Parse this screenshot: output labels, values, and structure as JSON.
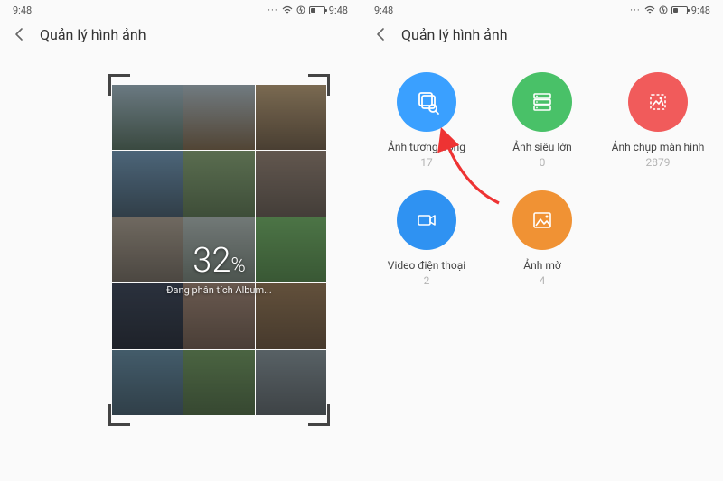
{
  "statusbar": {
    "time": "9:48",
    "time_right": "9:48"
  },
  "header": {
    "title": "Quản lý hình ảnh"
  },
  "left": {
    "progress_percent": "32",
    "progress_sign": "%",
    "progress_label": "Đang phân tích Album..."
  },
  "categories": [
    {
      "label": "Ảnh tương đồng",
      "count": "17",
      "color": "#3aa0ff",
      "icon": "similar"
    },
    {
      "label": "Ảnh siêu lớn",
      "count": "0",
      "color": "#49c168",
      "icon": "server"
    },
    {
      "label": "Ảnh chụp màn hình",
      "count": "2879",
      "color": "#f15b5b",
      "icon": "screenshot"
    },
    {
      "label": "Video điện thoại",
      "count": "2",
      "color": "#2f92f2",
      "icon": "video"
    },
    {
      "label": "Ảnh mờ",
      "count": "4",
      "color": "#f09234",
      "icon": "blur"
    }
  ]
}
